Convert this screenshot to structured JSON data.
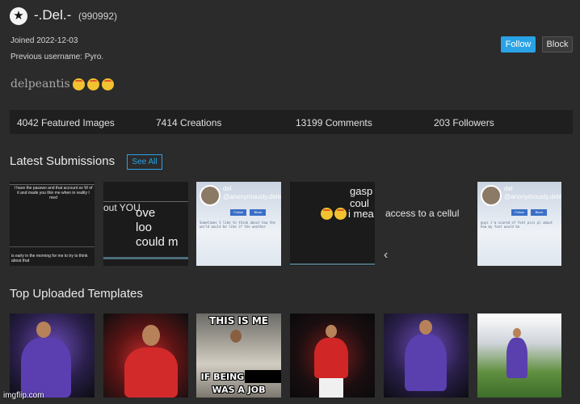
{
  "profile": {
    "username": "-.Del.-",
    "points": "(990992)",
    "joined": "Joined 2022-12-03",
    "previous_username": "Previous username: Pyro.",
    "bio_text": "delpeantis",
    "follow_label": "Follow",
    "block_label": "Block"
  },
  "stats": {
    "featured": "4042 Featured Images",
    "creations": "7414 Creations",
    "comments": "13199 Comments",
    "followers": "203 Followers"
  },
  "latest": {
    "title": "Latest Submissions",
    "see_all": "See All",
    "thumb1_text": "I have the passwo and that account so W of it and made you thin me when in reality I med",
    "thumb1_bottom": "is early in the morning for me to try to think about that",
    "thumb2_text": "out YOU",
    "thumb3_lines": [
      "ove",
      "loo",
      "could m"
    ],
    "thumb4_name": "del",
    "thumb4_handle": "@anonymously.delete",
    "thumb4_mini1": "Follow",
    "thumb4_mini2": "Block",
    "thumb4_body": "Sometimes I like to think about how the world would be like if the weather",
    "thumb5_lines": [
      "gasp",
      "coul",
      "i mea"
    ],
    "thumb6_text": "access to a cellul",
    "thumb6_arrow": "‹",
    "thumb7_name": "del",
    "thumb7_handle": "@anonymously.delete",
    "thumb7_mini1": "Follow",
    "thumb7_mini2": "Block",
    "thumb7_body": "guys i'm scared of foot pics pl about how my foot would be"
  },
  "templates": {
    "title": "Top Uploaded Templates",
    "bed_top": "THIS IS ME",
    "bed_mid": "IF BEING",
    "bed_bottom": "WAS A JOB"
  },
  "footer": {
    "watermark": "imgflip.com"
  },
  "icons": {
    "badge": "star-icon"
  },
  "colors": {
    "accent": "#2aa3e6",
    "background": "#2b2b2b",
    "stats_bar": "#1f1f1f"
  }
}
